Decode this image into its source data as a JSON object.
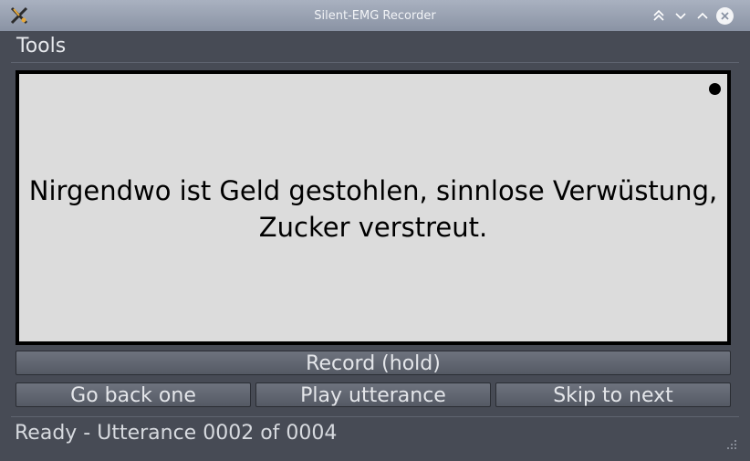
{
  "window": {
    "title": "Silent-EMG Recorder",
    "icons": [
      "app-logo-icon",
      "keep-above-icon",
      "minimize-icon",
      "maximize-icon",
      "close-icon"
    ]
  },
  "menubar": {
    "tools_label": "Tools"
  },
  "prompt": {
    "line1": "Nirgendwo ist Geld gestohlen, sinnlose Verwüstung,",
    "line2": "Zucker verstreut.",
    "background": "#dcdcdc",
    "border_color": "#000000",
    "recording_indicator_icon": "recording-dot-icon"
  },
  "buttons": {
    "record": "Record (hold)",
    "back": "Go back one",
    "play": "Play utterance",
    "skip": "Skip to next"
  },
  "status": {
    "text": "Ready - Utterance 0002 of 0004"
  },
  "colors": {
    "titlebar": "#9aa2b2",
    "window_bg": "#474b55",
    "button": "#5f646e"
  }
}
